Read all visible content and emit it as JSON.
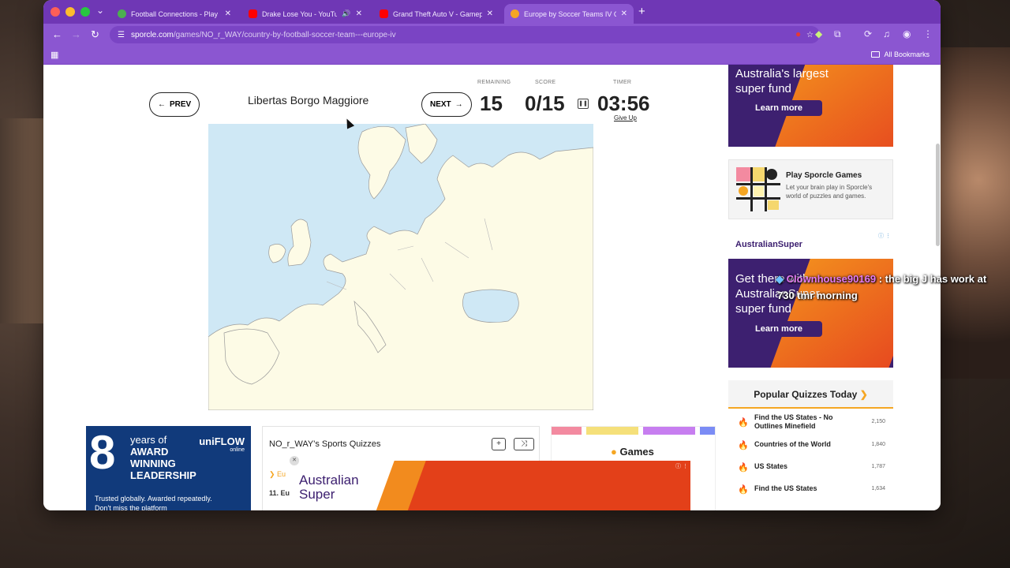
{
  "browser": {
    "tabs": [
      {
        "title": "Football Connections - Play M",
        "favicon_color": "#4caf50",
        "active": false
      },
      {
        "title": "Drake Lose You - YouTube",
        "favicon_color": "#ff0000",
        "active": false
      },
      {
        "title": "Grand Theft Auto V - Gamepl",
        "favicon_color": "#ff0000",
        "active": false
      },
      {
        "title": "Europe by Soccer Teams IV Q",
        "favicon_color": "#f5a623",
        "active": true
      }
    ],
    "url_host": "sporcle.com",
    "url_path": "/games/NO_r_WAY/country-by-football-soccer-team---europe-iv",
    "bookmarks_label": "All Bookmarks"
  },
  "quiz": {
    "prev_label": "PREV",
    "next_label": "NEXT",
    "current_answer": "Libertas Borgo Maggiore",
    "remaining_label": "REMAINING",
    "remaining_value": "15",
    "score_label": "SCORE",
    "score_value": "0/15",
    "timer_label": "TIMER",
    "timer_value": "03:56",
    "give_up_label": "Give Up"
  },
  "ads": {
    "top_headline": [
      "Australia's largest",
      "super fund"
    ],
    "learn_more": "Learn more",
    "australian_super": "AustralianSuper",
    "mid_headline": [
      "Get there with",
      "AustralianSuper",
      "super fund"
    ],
    "uniflow": {
      "number": "8",
      "lines": [
        "years of",
        "AWARD",
        "WINNING",
        "LEADERSHIP"
      ],
      "brand": "uniFLOW",
      "brand_sub": "online",
      "tagline": [
        "Trusted globally. Awarded repeatedly.",
        "Don't miss the platform"
      ]
    },
    "overlay_logo": [
      "Australian",
      "Super"
    ]
  },
  "play_card": {
    "title": "Play Sporcle Games",
    "description": "Let your brain play in Sporcle's world of puzzles and games."
  },
  "popular": {
    "heading": "Popular Quizzes Today",
    "items": [
      {
        "name": "Find the US States - No Outlines Minefield",
        "count": "2,150"
      },
      {
        "name": "Countries of the World",
        "count": "1,840"
      },
      {
        "name": "US States",
        "count": "1,787"
      },
      {
        "name": "Find the US States",
        "count": "1,634"
      }
    ]
  },
  "sports_box": {
    "title": "NO_r_WAY's Sports Quizzes",
    "item_first": "Eu",
    "item_second": "11. Eu"
  },
  "games_box": {
    "title": "Games"
  },
  "chat": {
    "username": "Clownhouse90169",
    "message_line1": ": the big J has work at",
    "message_line2": "730 tmr morning"
  }
}
